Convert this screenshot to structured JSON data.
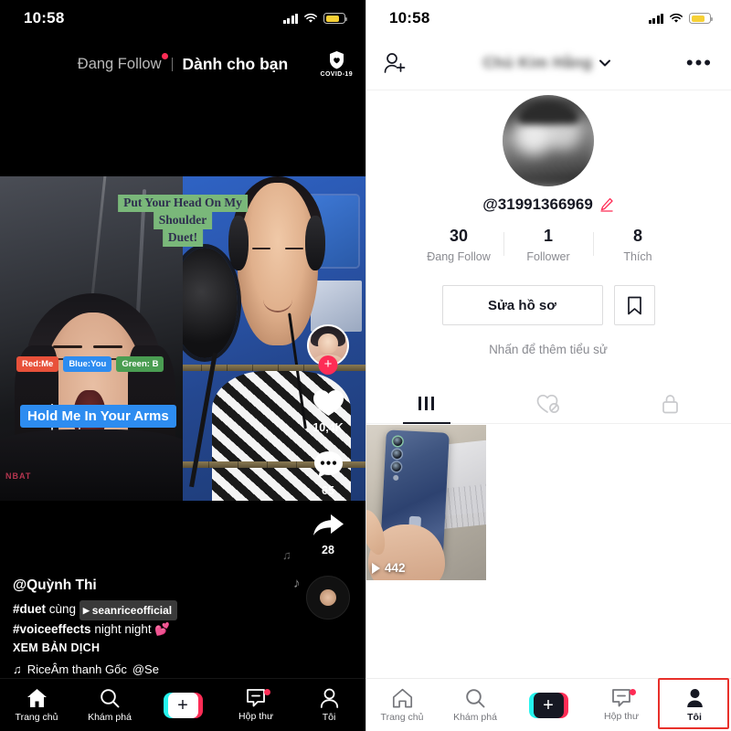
{
  "left": {
    "status": {
      "time": "10:58",
      "signal_icon": "signal-bars-icon",
      "wifi_icon": "wifi-icon",
      "battery_icon": "battery-icon"
    },
    "header": {
      "tab_following": "Đang Follow",
      "tab_foryou": "Dành cho bạn",
      "covid_label": "COVID-19",
      "covid_icon": "shield-heart-icon"
    },
    "video": {
      "overlay_title_lines": [
        "Put Your Head On My",
        "Shoulder",
        "Duet!"
      ],
      "chips": [
        {
          "label": "Red:Me",
          "color": "#e8513a"
        },
        {
          "label": "Blue:You",
          "color": "#2d8cf0"
        },
        {
          "label": "Green: B",
          "color": "#4a9d52"
        }
      ],
      "lyric": "Hold Me In Your Arms",
      "watermark": "NBAT"
    },
    "rail": {
      "avatar_name": "creator-avatar",
      "follow_plus": "+",
      "like_count": "10,4K",
      "comment_count": "65",
      "share_count": "28",
      "like_icon": "heart-icon",
      "comment_icon": "comment-icon",
      "share_icon": "share-arrow-icon",
      "disc_icon": "music-disc-icon"
    },
    "caption": {
      "username": "@Quỳnh Thi",
      "tag1": "#duet",
      "tag1_rest": "cùng",
      "mention": "seanriceofficial",
      "tag2": "#voiceeffects",
      "tag2_rest": "night night",
      "emoji": "💕",
      "translate": "XEM BẢN DỊCH",
      "music_note": "♫",
      "music_text": "RiceÂm thanh Gốc",
      "music_author": "@Se"
    },
    "nav": {
      "items": [
        {
          "label": "Trang chủ",
          "icon": "home-icon",
          "active": true
        },
        {
          "label": "Khám phá",
          "icon": "search-icon",
          "active": false
        },
        {
          "label": "",
          "icon": "create-plus-icon",
          "active": false
        },
        {
          "label": "Hộp thư",
          "icon": "inbox-icon",
          "active": false,
          "badge": true
        },
        {
          "label": "Tôi",
          "icon": "person-icon",
          "active": false
        }
      ]
    }
  },
  "right": {
    "status": {
      "time": "10:58",
      "signal_icon": "signal-bars-icon",
      "wifi_icon": "wifi-icon",
      "battery_icon": "battery-icon"
    },
    "header": {
      "add_friend_icon": "add-person-icon",
      "display_name": "Chủ Kim Hằng",
      "chevron_icon": "chevron-down-icon",
      "more_icon": "more-dots-icon"
    },
    "profile": {
      "avatar_name": "profile-avatar",
      "handle": "@31991366969",
      "edit_pencil_icon": "pencil-edit-icon",
      "stats": [
        {
          "num": "30",
          "label": "Đang Follow"
        },
        {
          "num": "1",
          "label": "Follower"
        },
        {
          "num": "8",
          "label": "Thích"
        }
      ],
      "edit_profile_button": "Sửa hồ sơ",
      "bookmark_icon": "bookmark-icon",
      "bio_placeholder": "Nhấn để thêm tiểu sử"
    },
    "tabs": [
      {
        "icon": "grid-icon",
        "active": true
      },
      {
        "icon": "heart-hidden-icon",
        "active": false
      },
      {
        "icon": "lock-icon",
        "active": false
      }
    ],
    "grid": {
      "first_video_views": "442",
      "play_icon": "play-icon"
    },
    "nav": {
      "items": [
        {
          "label": "Trang chủ",
          "icon": "home-icon",
          "active": false
        },
        {
          "label": "Khám phá",
          "icon": "search-icon",
          "active": false
        },
        {
          "label": "",
          "icon": "create-plus-icon",
          "active": false
        },
        {
          "label": "Hộp thư",
          "icon": "inbox-icon",
          "active": false,
          "badge": true
        },
        {
          "label": "Tôi",
          "icon": "person-icon",
          "active": true
        }
      ]
    },
    "annotation": {
      "highlight_color": "#e8302a",
      "target": "Tôi"
    }
  }
}
